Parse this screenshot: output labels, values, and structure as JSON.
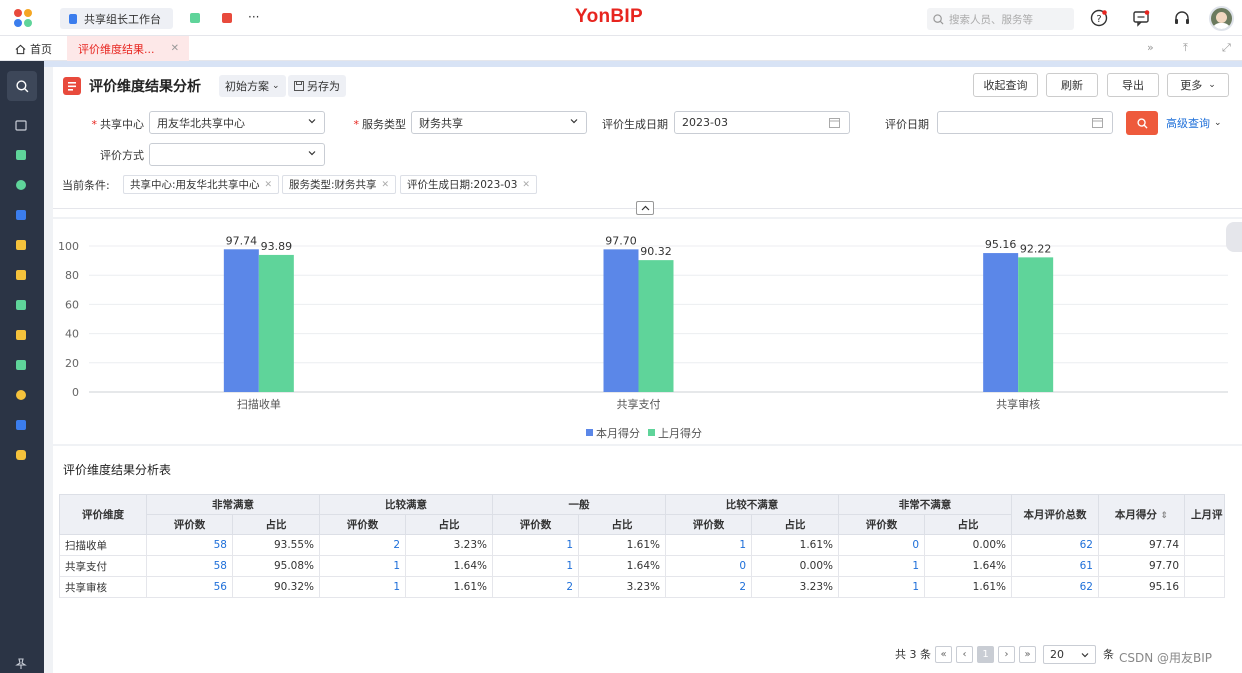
{
  "topbar": {
    "workspace_tab": "共享组长工作台",
    "more": "···",
    "brand": "YonBIP",
    "search_placeholder": "搜索人员、服务等"
  },
  "tabs": {
    "home": "首页",
    "active": "评价维度结果..."
  },
  "page": {
    "title": "评价维度结果分析",
    "scheme": "初始方案",
    "save_as": "另存为",
    "buttons": {
      "collapse_query": "收起查询",
      "refresh": "刷新",
      "export": "导出",
      "more": "更多"
    }
  },
  "filters": {
    "share_center_label": "共享中心",
    "share_center_value": "用友华北共享中心",
    "service_type_label": "服务类型",
    "service_type_value": "财务共享",
    "gen_date_label": "评价生成日期",
    "gen_date_value": "2023-03",
    "eval_date_label": "评价日期",
    "eval_date_value": "",
    "method_label": "评价方式",
    "method_value": "",
    "advanced": "高级查询",
    "current_label": "当前条件:",
    "chips": [
      "共享中心:用友华北共享中心",
      "服务类型:财务共享",
      "评价生成日期:2023-03"
    ]
  },
  "chart_data": {
    "type": "bar",
    "categories": [
      "扫描收单",
      "共享支付",
      "共享审核"
    ],
    "series": [
      {
        "name": "本月得分",
        "values": [
          97.74,
          97.7,
          95.16
        ],
        "color": "#5b87e8"
      },
      {
        "name": "上月得分",
        "values": [
          93.89,
          90.32,
          92.22
        ],
        "color": "#5fd49a"
      }
    ],
    "ylim": [
      0,
      100
    ],
    "yticks": [
      0,
      20,
      40,
      60,
      80,
      100
    ],
    "legend_position": "bottom-center",
    "grid": true
  },
  "table": {
    "title": "评价维度结果分析表",
    "dim_header": "评价维度",
    "groups": [
      "非常满意",
      "比较满意",
      "一般",
      "比较不满意",
      "非常不满意"
    ],
    "sub_count": "评价数",
    "sub_ratio": "占比",
    "total_header": "本月评价总数",
    "score_header": "本月得分",
    "last_header": "上月评",
    "rows": [
      {
        "name": "扫描收单",
        "cells": [
          "58",
          "93.55%",
          "2",
          "3.23%",
          "1",
          "1.61%",
          "1",
          "1.61%",
          "0",
          "0.00%"
        ],
        "total": "62",
        "score": "97.74"
      },
      {
        "name": "共享支付",
        "cells": [
          "58",
          "95.08%",
          "1",
          "1.64%",
          "1",
          "1.64%",
          "0",
          "0.00%",
          "1",
          "1.64%"
        ],
        "total": "61",
        "score": "97.70"
      },
      {
        "name": "共享审核",
        "cells": [
          "56",
          "90.32%",
          "1",
          "1.61%",
          "2",
          "3.23%",
          "2",
          "3.23%",
          "1",
          "1.61%"
        ],
        "total": "62",
        "score": "95.16"
      }
    ]
  },
  "pager": {
    "total": "共 3 条",
    "current_page": "1",
    "page_size": "20",
    "unit": "条",
    "watermark": "CSDN @用友BIP"
  }
}
